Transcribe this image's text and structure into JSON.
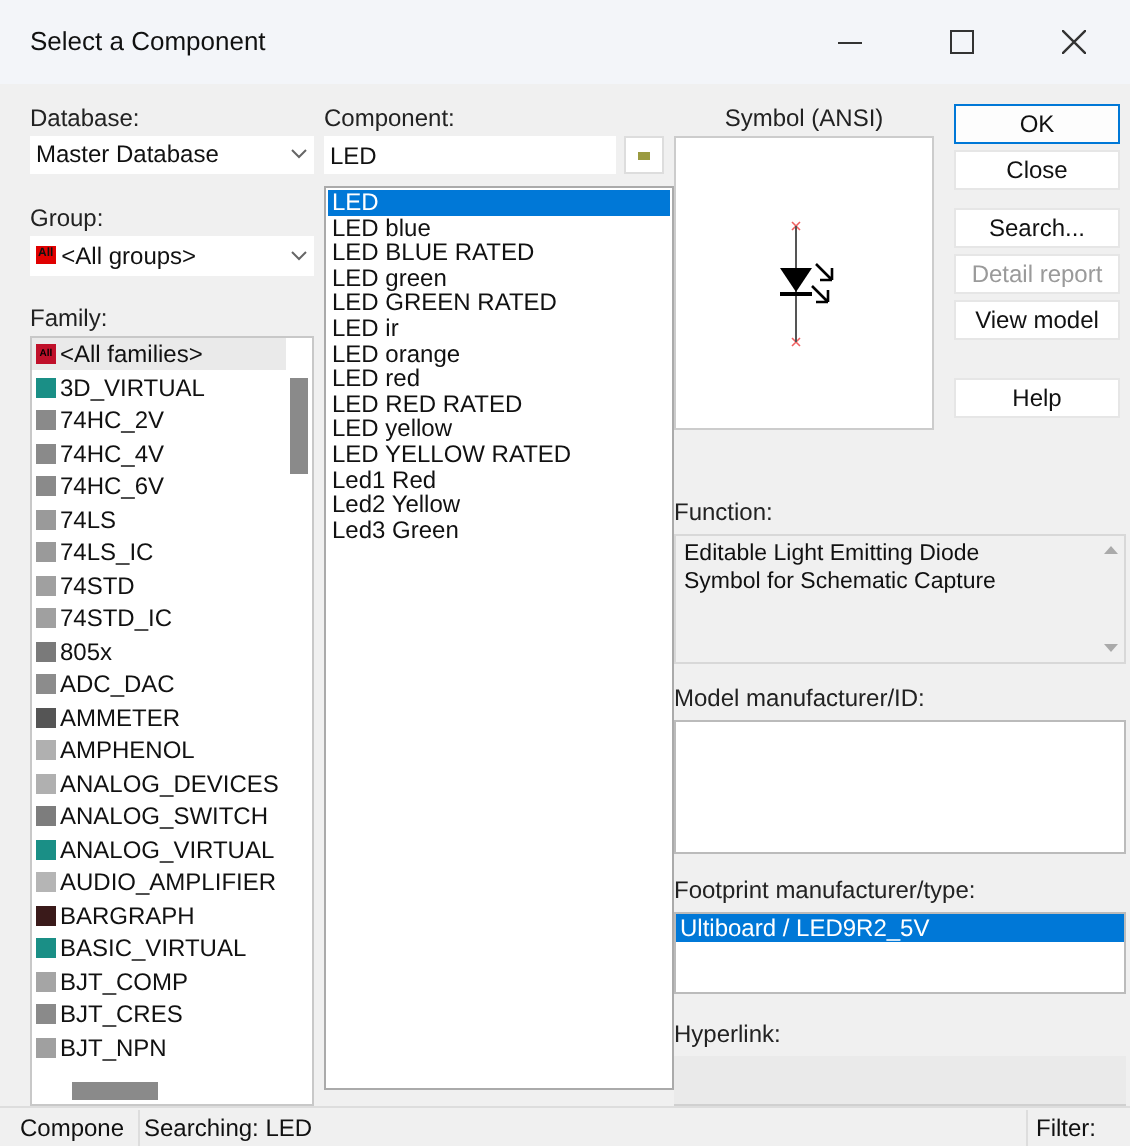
{
  "window": {
    "title": "Select a Component"
  },
  "database": {
    "label": "Database:",
    "value": "Master Database"
  },
  "group": {
    "label": "Group:",
    "value": "<All groups>",
    "icon_text": "All"
  },
  "family": {
    "label": "Family:",
    "items": [
      {
        "name": "<All families>",
        "selected": true,
        "color": "#c0102a",
        "icon_text": "All"
      },
      {
        "name": "3D_VIRTUAL",
        "selected": false,
        "color": "#1a8f86"
      },
      {
        "name": "74HC_2V",
        "selected": false,
        "color": "#8a8a8a"
      },
      {
        "name": "74HC_4V",
        "selected": false,
        "color": "#8a8a8a"
      },
      {
        "name": "74HC_6V",
        "selected": false,
        "color": "#8a8a8a"
      },
      {
        "name": "74LS",
        "selected": false,
        "color": "#9a9a9a"
      },
      {
        "name": "74LS_IC",
        "selected": false,
        "color": "#9a9a9a"
      },
      {
        "name": "74STD",
        "selected": false,
        "color": "#a0a0a0"
      },
      {
        "name": "74STD_IC",
        "selected": false,
        "color": "#a0a0a0"
      },
      {
        "name": "805x",
        "selected": false,
        "color": "#7a7a7a"
      },
      {
        "name": "ADC_DAC",
        "selected": false,
        "color": "#8c8c8c"
      },
      {
        "name": "AMMETER",
        "selected": false,
        "color": "#555555"
      },
      {
        "name": "AMPHENOL",
        "selected": false,
        "color": "#b0b0b0"
      },
      {
        "name": "ANALOG_DEVICES",
        "selected": false,
        "color": "#b0b0b0"
      },
      {
        "name": "ANALOG_SWITCH",
        "selected": false,
        "color": "#7d7d7d"
      },
      {
        "name": "ANALOG_VIRTUAL",
        "selected": false,
        "color": "#1a8f86"
      },
      {
        "name": "AUDIO_AMPLIFIER",
        "selected": false,
        "color": "#b5b5b5"
      },
      {
        "name": "BARGRAPH",
        "selected": false,
        "color": "#3a1a1a"
      },
      {
        "name": "BASIC_VIRTUAL",
        "selected": false,
        "color": "#1a8f86"
      },
      {
        "name": "BJT_COMP",
        "selected": false,
        "color": "#a5a5a5"
      },
      {
        "name": "BJT_CRES",
        "selected": false,
        "color": "#8a8a8a"
      },
      {
        "name": "BJT_NPN",
        "selected": false,
        "color": "#a0a0a0"
      }
    ]
  },
  "component": {
    "label": "Component:",
    "value": "LED",
    "items": [
      {
        "name": "LED",
        "selected": true
      },
      {
        "name": "LED blue",
        "selected": false
      },
      {
        "name": "LED BLUE RATED",
        "selected": false
      },
      {
        "name": "LED green",
        "selected": false
      },
      {
        "name": "LED GREEN RATED",
        "selected": false
      },
      {
        "name": "LED ir",
        "selected": false
      },
      {
        "name": "LED orange",
        "selected": false
      },
      {
        "name": "LED red",
        "selected": false
      },
      {
        "name": "LED RED RATED",
        "selected": false
      },
      {
        "name": "LED yellow",
        "selected": false
      },
      {
        "name": "LED YELLOW RATED",
        "selected": false
      },
      {
        "name": "Led1 Red",
        "selected": false
      },
      {
        "name": "Led2 Yellow",
        "selected": false
      },
      {
        "name": "Led3 Green",
        "selected": false
      }
    ]
  },
  "symbol": {
    "label": "Symbol (ANSI)"
  },
  "buttons": [
    {
      "label": "OK",
      "disabled": false,
      "default": true
    },
    {
      "label": "Close",
      "disabled": false,
      "default": false
    },
    {
      "label": "Search...",
      "disabled": false,
      "default": false
    },
    {
      "label": "Detail report",
      "disabled": true,
      "default": false
    },
    {
      "label": "View model",
      "disabled": false,
      "default": false
    },
    {
      "label": "Help",
      "disabled": false,
      "default": false
    }
  ],
  "function": {
    "label": "Function:",
    "text": "Editable Light Emitting Diode Symbol for Schematic Capture"
  },
  "model": {
    "label": "Model manufacturer/ID:"
  },
  "footprint": {
    "label": "Footprint manufacturer/type:",
    "items": [
      {
        "name": "Ultiboard / LED9R2_5V",
        "selected": true
      }
    ]
  },
  "hyperlink": {
    "label": "Hyperlink:"
  },
  "status_bar": [
    "Compone",
    "Searching: LED",
    "Filter:"
  ]
}
